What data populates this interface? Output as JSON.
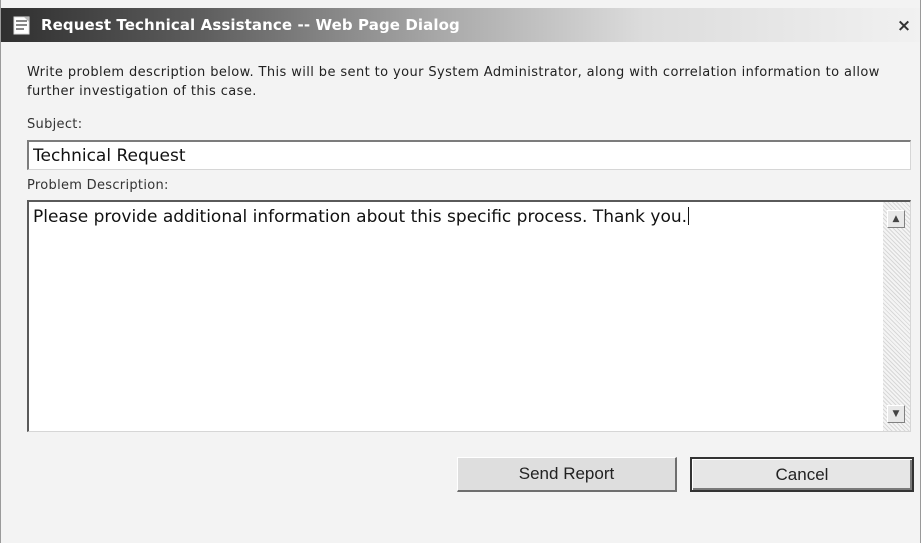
{
  "window": {
    "title": "Request Technical Assistance -- Web Page Dialog",
    "close_glyph": "×",
    "icon": "dialog-app-icon"
  },
  "instructions": "Write problem description below. This will be sent to your System Administrator, along with correlation information to allow further investigation of this case.",
  "subject": {
    "label": "Subject:",
    "value": "Technical Request"
  },
  "description": {
    "label": "Problem Description:",
    "value": "Please provide additional information about this specific process.  Thank you.",
    "scroll_up_glyph": "▲",
    "scroll_down_glyph": "▼"
  },
  "buttons": {
    "send_label": "Send Report",
    "cancel_label": "Cancel"
  }
}
